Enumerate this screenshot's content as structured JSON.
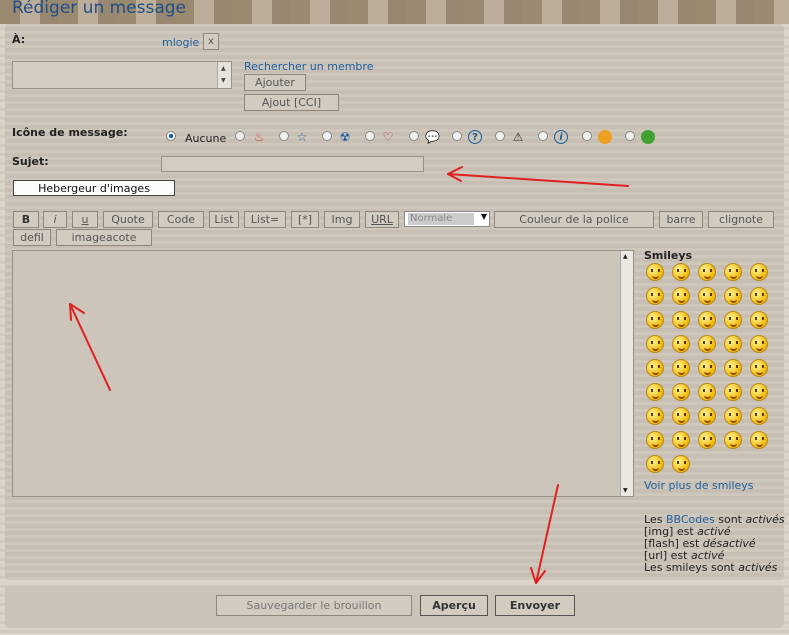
{
  "page": {
    "title": "Rédiger un message"
  },
  "recipient": {
    "label": "À:",
    "user": "mlogie",
    "remove": "x",
    "search_link": "Rechercher un membre",
    "add_button": "Ajouter",
    "add_bcc_button": "Ajout [CCI]"
  },
  "message_icon": {
    "label": "Icône de message:",
    "none_label": "Aucune",
    "icons": [
      "flame-icon",
      "star-icon",
      "radioactive-icon",
      "heart-icon",
      "speech-bubble-icon",
      "question-icon",
      "warning-icon",
      "info-icon",
      "orange-smiley-icon",
      "green-smiley-icon"
    ]
  },
  "subject": {
    "label": "Sujet:",
    "value": ""
  },
  "image_host_button": "Hebergeur d'images",
  "toolbar": {
    "buttons": [
      "B",
      "i",
      "u",
      "Quote",
      "Code",
      "List",
      "List=",
      "[*]",
      "Img",
      "URL"
    ],
    "size_select": "Normale",
    "color_button": "Couleur de la police",
    "bar_button": "barre",
    "blink_button": "clignote",
    "row2": [
      "defil",
      "imageacote"
    ]
  },
  "smileys": {
    "title": "Smileys",
    "more_link": "Voir plus de smileys",
    "count": 42
  },
  "status": {
    "bbcodes_prefix": "Les ",
    "bbcodes_link": "BBCodes",
    "bbcodes_mid": " sont ",
    "bbcodes_state": "activés",
    "img_prefix": "[img] est ",
    "img_state": "activé",
    "flash_prefix": "[flash] est ",
    "flash_state": "désactivé",
    "url_prefix": "[url] est ",
    "url_state": "activé",
    "smileys_prefix": "Les smileys sont ",
    "smileys_state": "activés"
  },
  "actions": {
    "save_draft": "Sauvegarder le brouillon",
    "preview": "Aperçu",
    "send": "Envoyer"
  },
  "colors": {
    "title": "#1f4f86",
    "link": "#1f5fa0",
    "annotation_arrow": "#e02020"
  }
}
